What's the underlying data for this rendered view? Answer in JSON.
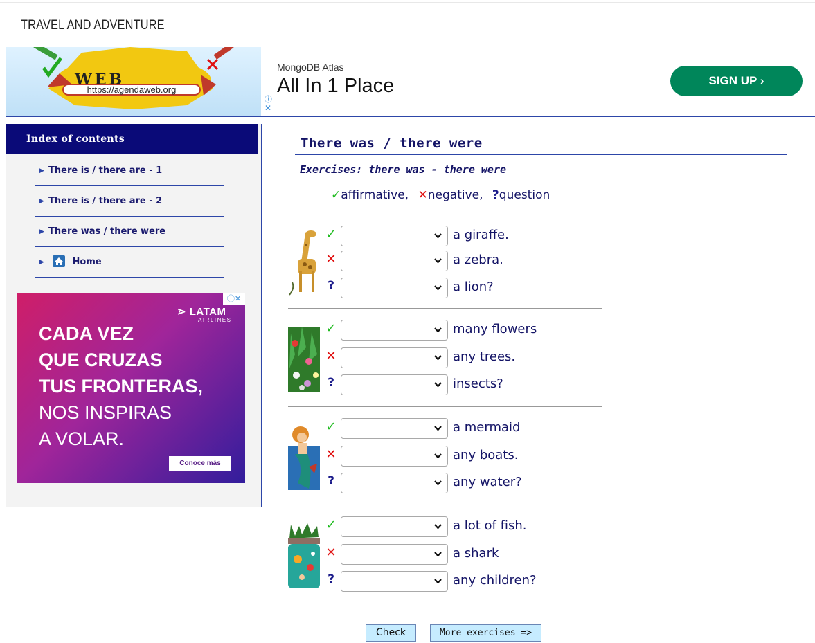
{
  "site": {
    "title": "TRAVEL AND ADVENTURE"
  },
  "logo": {
    "word": "WEB",
    "url": "https://agendaweb.org"
  },
  "top_ad": {
    "brand": "MongoDB Atlas",
    "headline": "All In 1 Place",
    "cta": "SIGN UP ›",
    "info": "ⓘ",
    "close": "✕"
  },
  "sidebar": {
    "heading": "Index of contents",
    "items": [
      {
        "label": "There is / there are - 1"
      },
      {
        "label": "There is / there are - 2"
      },
      {
        "label": "There was / there were"
      },
      {
        "label": "Home"
      }
    ]
  },
  "side_ad": {
    "brand": "LATAM",
    "brand_sub": "AIRLINES",
    "lines": [
      "CADA VEZ",
      "QUE CRUZAS",
      "TUS FRONTERAS,",
      "NOS INSPIRAS",
      "A VOLAR."
    ],
    "cta": "Conoce más",
    "tag": "ⓘ✕"
  },
  "main": {
    "title": "There was / there were",
    "subtitle": "Exercises: there was - there were",
    "legend": {
      "affirmative": "affirmative,",
      "negative": "negative,",
      "question": "question"
    }
  },
  "groups": [
    {
      "picture": "giraffe",
      "rows": [
        {
          "mark": "✓",
          "value": "",
          "phrase": "a giraffe."
        },
        {
          "mark": "✕",
          "value": "",
          "phrase": "a zebra."
        },
        {
          "mark": "?",
          "value": "",
          "phrase": "a lion?"
        }
      ]
    },
    {
      "picture": "flowers",
      "rows": [
        {
          "mark": "✓",
          "value": "",
          "phrase": "many flowers"
        },
        {
          "mark": "✕",
          "value": "",
          "phrase": "any trees."
        },
        {
          "mark": "?",
          "value": "",
          "phrase": "insects?"
        }
      ]
    },
    {
      "picture": "mermaid",
      "rows": [
        {
          "mark": "✓",
          "value": "",
          "phrase": "a mermaid"
        },
        {
          "mark": "✕",
          "value": "",
          "phrase": "any boats."
        },
        {
          "mark": "?",
          "value": "",
          "phrase": "any water?"
        }
      ]
    },
    {
      "picture": "pool",
      "rows": [
        {
          "mark": "✓",
          "value": "",
          "phrase": "a lot of fish."
        },
        {
          "mark": "✕",
          "value": "",
          "phrase": "a shark"
        },
        {
          "mark": "?",
          "value": "",
          "phrase": "any children?"
        }
      ]
    }
  ],
  "buttons": {
    "check": "Check",
    "more": "More exercises =>"
  },
  "colors": {
    "navy": "#0a0a78",
    "accent": "#2d46a8",
    "ok": "#22bb22",
    "no": "#e01010",
    "signup": "#00865a",
    "button": "#c6ecff"
  }
}
